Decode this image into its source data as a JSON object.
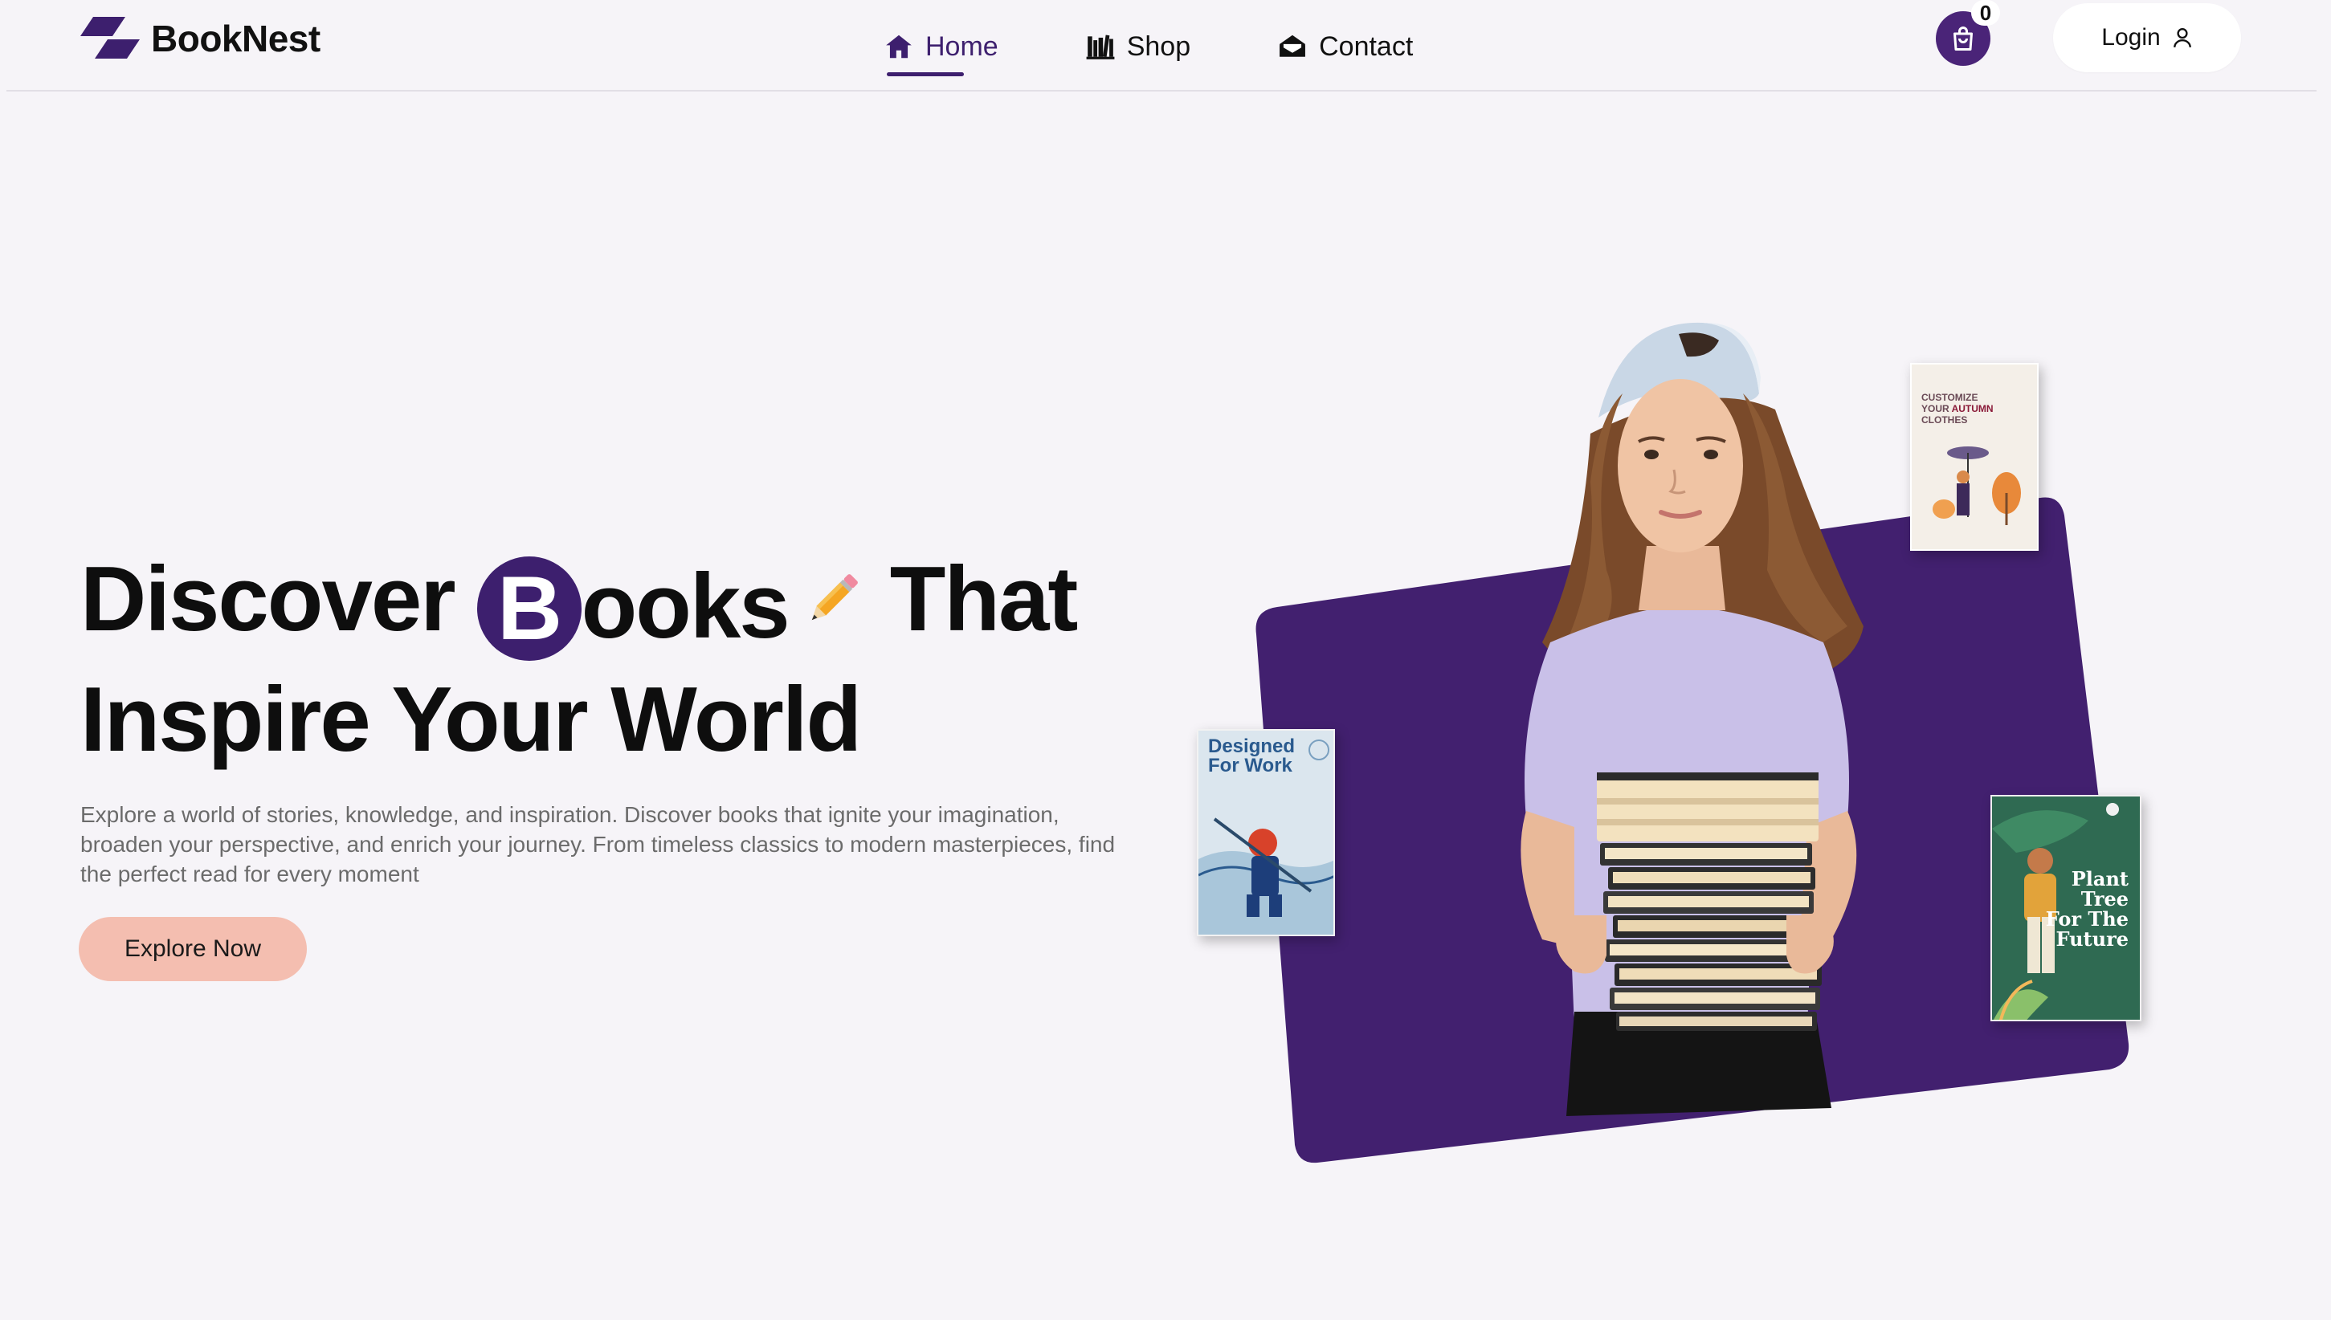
{
  "brand": {
    "name": "BookNest"
  },
  "nav": {
    "items": [
      {
        "label": "Home",
        "icon": "home-icon",
        "active": true
      },
      {
        "label": "Shop",
        "icon": "bookshelf-icon",
        "active": false
      },
      {
        "label": "Contact",
        "icon": "envelope-icon",
        "active": false
      }
    ]
  },
  "cart": {
    "icon": "shopping-bag-icon",
    "count": "0"
  },
  "login": {
    "label": "Login",
    "icon": "user-icon"
  },
  "hero": {
    "headline": {
      "word1": "Discover",
      "b_letter": "B",
      "word2_rest": "ooks",
      "emoji_icon": "pencil-icon",
      "word3": "That",
      "line2": "Inspire Your World"
    },
    "description": "Explore a world of stories, knowledge, and inspiration. Discover books that ignite your imagination, broaden your perspective, and enrich your journey. From timeless classics to modern masterpieces, find the perfect read for every moment",
    "cta_label": "Explore Now",
    "books": [
      {
        "title_line1": "CUSTOMIZE",
        "title_line2_a": "YOUR ",
        "title_line2_b": "AUTUMN",
        "title_line3": "CLOTHES"
      },
      {
        "title": "Designed For Work"
      },
      {
        "title": "Plant Tree For The Future"
      }
    ]
  },
  "colors": {
    "accent_purple": "#3d1f6e",
    "cta_peach": "#f4beb0",
    "background": "#f6f4f8"
  }
}
